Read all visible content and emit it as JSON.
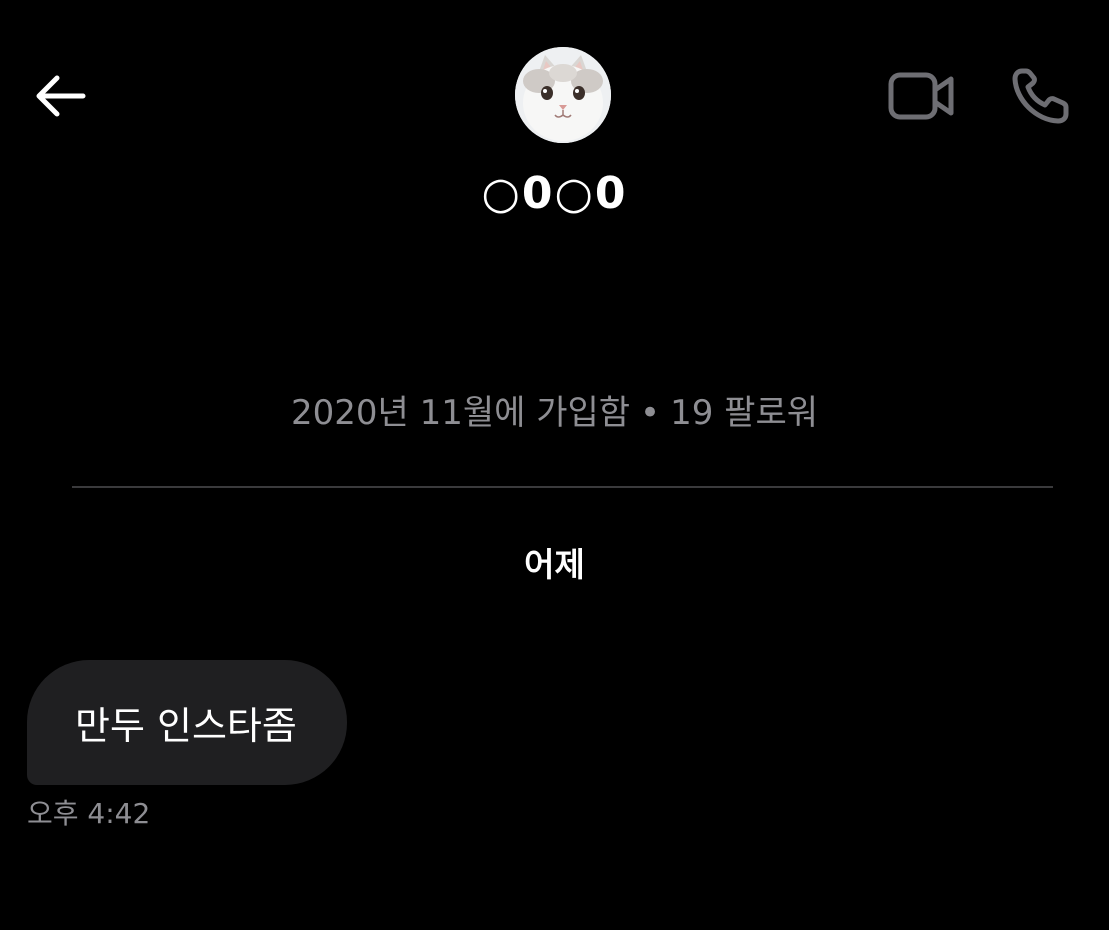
{
  "header": {
    "username": "○0○0",
    "back_icon": "arrow-left-icon",
    "video_icon": "video-camera-icon",
    "phone_icon": "phone-icon",
    "avatar": "kitten-avatar"
  },
  "profile": {
    "joined": "2020년 11월에 가입함",
    "separator": "•",
    "followers": "19 팔로워"
  },
  "conversation": {
    "day_label": "어제",
    "messages": [
      {
        "text": "만두 인스타좀",
        "time": "오후 4:42"
      }
    ]
  },
  "colors": {
    "background": "#000000",
    "bubble": "#1f1f21",
    "secondary_text": "#8e8e93",
    "icon_gray": "#6e6e73",
    "divider": "#3a3a3c"
  }
}
